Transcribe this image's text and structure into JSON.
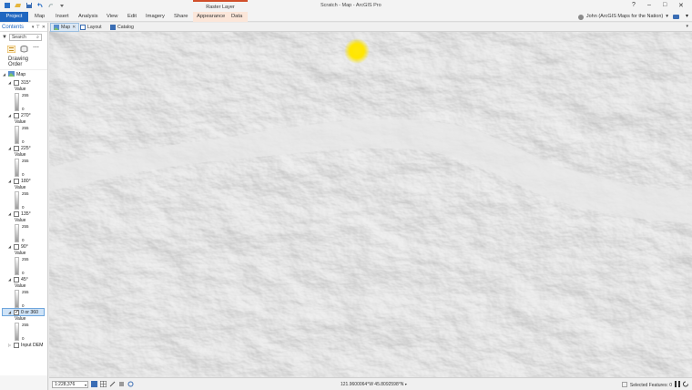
{
  "titlebar": {
    "context_tab_title": "Raster Layer",
    "window_title": "Scratch - Map - ArcGIS Pro",
    "help": "?",
    "minimize": "–",
    "maximize": "□",
    "close": "✕"
  },
  "ribbon": {
    "tabs": [
      "Project",
      "Map",
      "Insert",
      "Analysis",
      "View",
      "Edit",
      "Imagery",
      "Share",
      "Appearance",
      "Data"
    ],
    "user": "John (ArcGIS Maps for the Nation)"
  },
  "contents": {
    "title": "Contents",
    "search_placeholder": "Search",
    "drawing_order": "Drawing Order",
    "map_label": "Map",
    "layers": [
      {
        "name": "315°",
        "value_label": "Value",
        "high": "255",
        "low": "0"
      },
      {
        "name": "270°",
        "value_label": "Value",
        "high": "255",
        "low": "0"
      },
      {
        "name": "225°",
        "value_label": "Value",
        "high": "255",
        "low": "0"
      },
      {
        "name": "180°",
        "value_label": "Value",
        "high": "255",
        "low": "0"
      },
      {
        "name": "135°",
        "value_label": "Value",
        "high": "255",
        "low": "0"
      },
      {
        "name": "90°",
        "value_label": "Value",
        "high": "255",
        "low": "0"
      },
      {
        "name": "45°",
        "value_label": "Value",
        "high": "255",
        "low": "0"
      },
      {
        "name": "0 or 360",
        "value_label": "Value",
        "high": "255",
        "low": "0"
      }
    ],
    "input_dem": "Input DEM"
  },
  "viewtabs": {
    "tabs": [
      "Map",
      "Layout",
      "Catalog"
    ]
  },
  "statusbar": {
    "scale": "1:228,376",
    "coordinates": "121.9600064°W 45.8092598°N",
    "selected_features": "Selected Features: 0"
  },
  "colors": {
    "project_tab": "#1f66c0",
    "context_accent": "#d14f2b",
    "selection": "#cfe3f7",
    "pointer_highlight": "#ffe600"
  }
}
